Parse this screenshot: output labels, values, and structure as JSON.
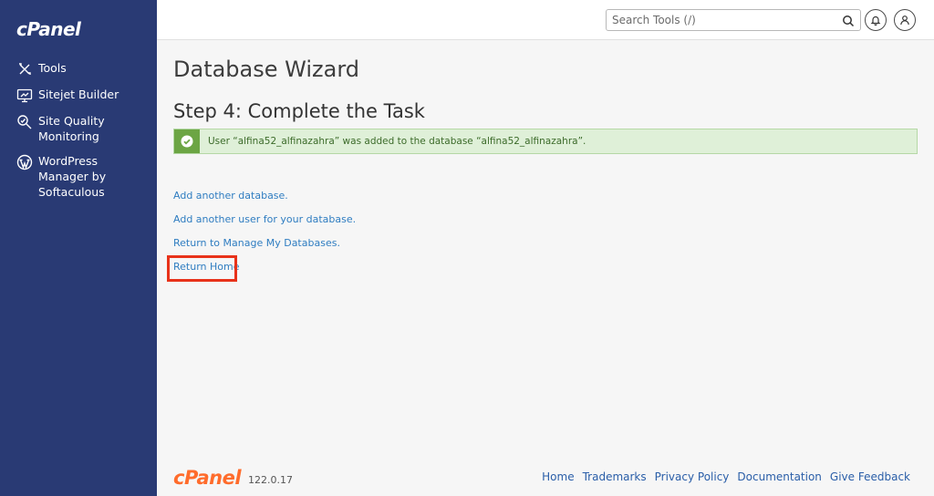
{
  "sidebar": {
    "logo": "cPanel",
    "items": [
      {
        "label": "Tools",
        "icon": "tools-icon"
      },
      {
        "label": "Sitejet Builder",
        "icon": "sitejet-icon"
      },
      {
        "label": "Site Quality Monitoring",
        "icon": "site-quality-icon"
      },
      {
        "label": "WordPress Manager by Softaculous",
        "icon": "wordpress-icon"
      }
    ]
  },
  "header": {
    "search_placeholder": "Search Tools (/)",
    "search_icon": "search-icon",
    "notifications_icon": "bell-icon",
    "user_icon": "user-icon"
  },
  "main": {
    "page_title": "Database Wizard",
    "step_title": "Step 4: Complete the Task",
    "alert_message": "User “alfina52_alfinazahra” was added to the database “alfina52_alfinazahra”.",
    "links": [
      "Add another database.",
      "Add another user for your database.",
      "Return to Manage My Databases.",
      "Return Home"
    ]
  },
  "footer": {
    "logo": "cPanel",
    "version": "122.0.17",
    "links": [
      "Home",
      "Trademarks",
      "Privacy Policy",
      "Documentation",
      "Give Feedback"
    ]
  },
  "colors": {
    "sidebar_bg": "#293a74",
    "link": "#2f7dc1",
    "success_bg": "#dff0d8",
    "success_icon": "#6ca544",
    "highlight": "#e8321a",
    "brand_orange": "#ff6c2c"
  }
}
